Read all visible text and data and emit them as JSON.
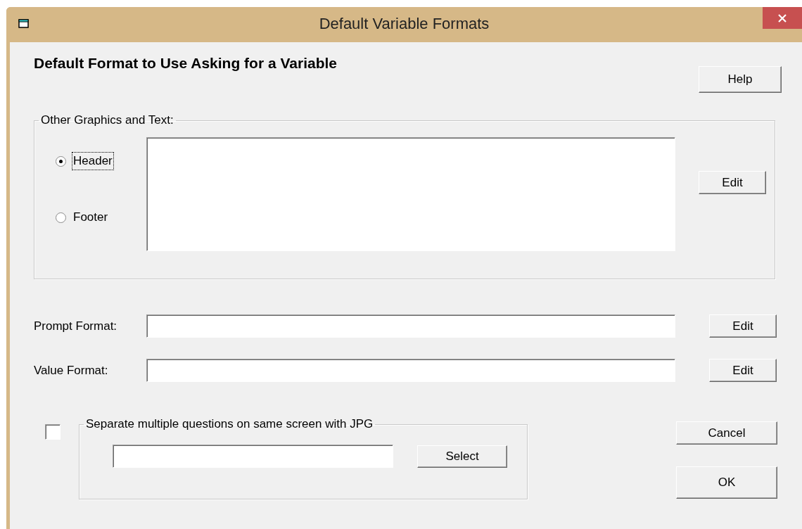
{
  "window": {
    "title": "Default Variable Formats"
  },
  "heading": "Default Format to Use Asking for a Variable",
  "help_button": "Help",
  "graphics_group": {
    "legend": "Other Graphics and Text:",
    "edit_button": "Edit",
    "options": [
      {
        "label": "Header",
        "selected": true,
        "focused": true
      },
      {
        "label": "Footer",
        "selected": false,
        "focused": false
      }
    ]
  },
  "fields": [
    {
      "label": "Prompt Format:",
      "button": "Edit"
    },
    {
      "label": "Value Format:",
      "button": "Edit"
    }
  ],
  "separator": {
    "checked": false,
    "legend": "Separate multiple questions on same screen with JPG",
    "button": "Select"
  },
  "buttons": [
    "Cancel",
    "OK"
  ]
}
